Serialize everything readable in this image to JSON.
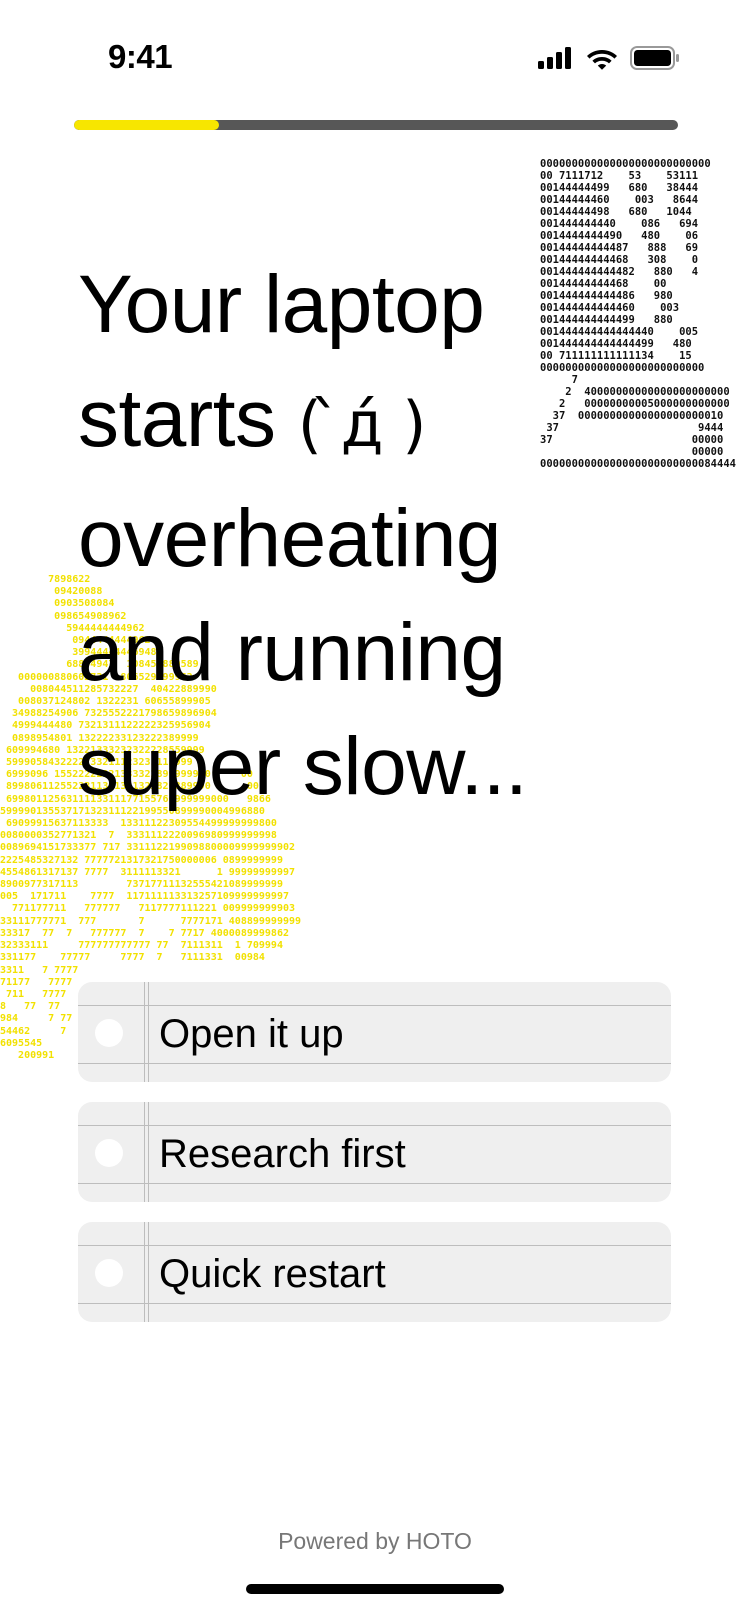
{
  "status_bar": {
    "time": "9:41",
    "icons": [
      "cellular-signal-icon",
      "wifi-icon",
      "battery-icon"
    ]
  },
  "progress": {
    "fraction": 0.24,
    "fill_color": "#f7e600",
    "track_color": "#575757"
  },
  "question": {
    "line1": "Your laptop",
    "line2_prefix": "starts",
    "kaomoji": "( ̀д́ )",
    "line3": "overheating",
    "line4": "and running",
    "line5": "super slow..."
  },
  "art": {
    "laptop_ascii": "000000000000000000000000000\n00 7111712    53    53111\n00144444499   680   38444\n00144444460    003   8644\n00144444498   680   1044\n001444444440    086   694\n0014444444490   480    06\n00144444444487   888   69\n00144444444468   308    0\n001444444444482   880   4\n00144444444468    00\n001444444444486   980\n001444444444460    003\n001444444444499   880\n001444444444444440    005\n001444444444444499   480\n00 711111111111134    15\n00000000000000000000000000\n     7\n    2  40000000000000000000000\n   2   00000000005000000000000\n  37  00000000000000000000010\n 37                      9444\n37                      00000\n                        00000\n0000000000000000000000000084444",
    "flame_ascii": "        7898622\n         09420088\n         0903508084\n         098654908962\n           5944444444962\n            0944444444962\n            39944444446948\n           68804947  108455889589\n   000000880602731  806529099962\n     008044511285732227  40422889990\n   008037124802 1322231 60655899905\n  34988254906 7325552221798659896904\n  4999444480 7321311122222325956904\n  0898954801 13222233123222389999\n 609994680 13221333232322228559999\n 5999058432222233211123231115999\n 6999096 15522222221333322899999990     00\n 8998061125522311311311322820889990      005\n 6998011256311113311177155760999999000   9866\n59999013553717132311122199550899990004996880\n 69099915637113333  13311122309554499999999800\n0080000352771321  7  3331112220096980999999998\n0089694151733377 717 3311122199098800009999999902\n2225485327132 7777721317321750000006 0899999999\n4554861317137 7777  3111113321      1 99999999997\n8900977317113        73717711132555421089999999\n005  171711    7777  117111113313257109999999997\n  771177711   777777   7117777111221 009999999903\n33111777771  777       7      7777171 408899999999\n33317  77  7   777777  7    7 7717 4000089999862\n32333111     777777777777 77  7111311  1 709994\n331177    77777     7777  7   7111331  00984\n3311   7 7777\n71177   7777\n 711   7777\n8   77  77\n984     7 77\n54462     7\n6095545\n   200991"
  },
  "options": [
    {
      "label": "Open it up",
      "selected": false
    },
    {
      "label": "Research first",
      "selected": false
    },
    {
      "label": "Quick restart",
      "selected": false
    }
  ],
  "footer": {
    "powered_by": "Powered by HOTO"
  }
}
